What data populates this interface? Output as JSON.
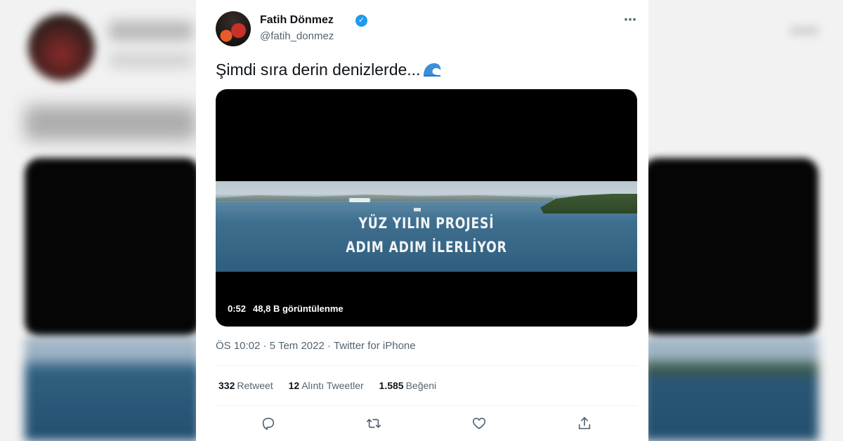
{
  "tweet": {
    "author_name": "Fatih Dönmez",
    "handle": "@fatih_donmez",
    "more_icon": "⋯",
    "verified_icon": "✓",
    "text": "Şimdi sıra derin denizlerde...",
    "emoji": "wave-icon",
    "timestamp": "ÖS 10:02 · 5 Tem 2022 · Twitter for iPhone"
  },
  "video": {
    "overlay_line1": "YÜZ YILIN PROJESİ",
    "overlay_line2": "ADIM ADIM İLERLİYOR",
    "duration": "0:52",
    "views": "48,8 B görüntülenme"
  },
  "stats": {
    "retweets_count": "332",
    "retweets_label": "Retweet",
    "quotes_count": "12",
    "quotes_label": "Alıntı Tweetler",
    "likes_count": "1.585",
    "likes_label": "Beğeni"
  },
  "actions": [
    "reply-icon",
    "retweet-icon",
    "like-icon",
    "share-icon"
  ],
  "colors": {
    "text": "#0f1419",
    "secondary": "#536471",
    "verified": "#1d9bf0",
    "divider": "#eff3f4"
  }
}
